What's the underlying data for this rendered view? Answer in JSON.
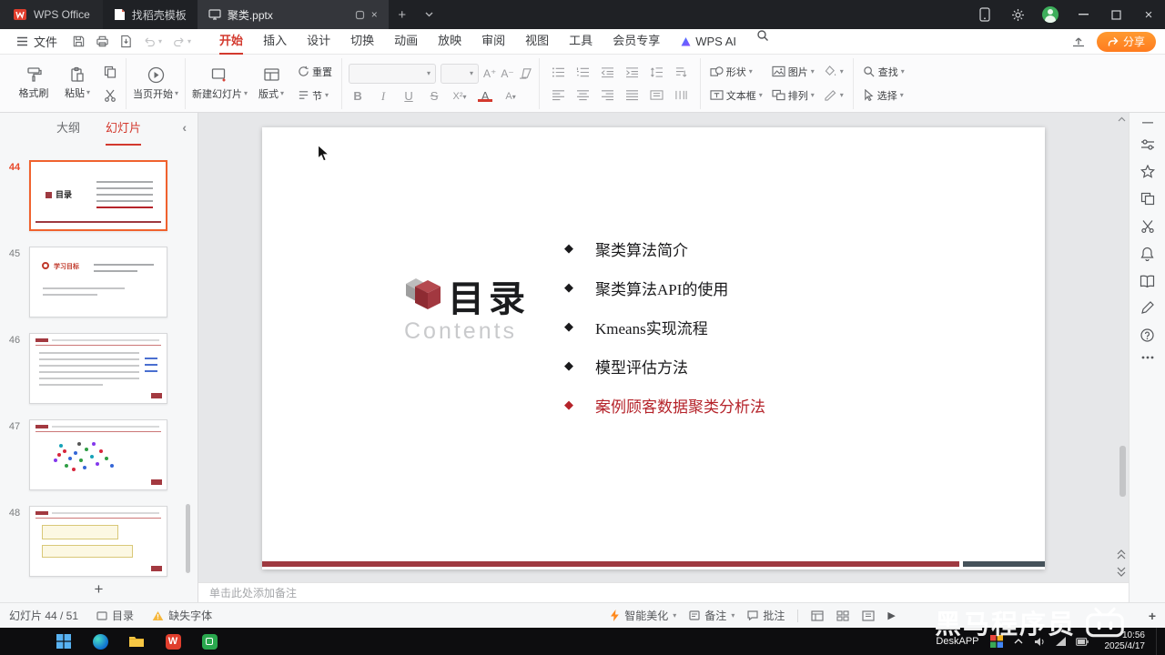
{
  "colors": {
    "accent_red": "#d3392e",
    "share_orange": "#ff7c1f",
    "slide_red": "#9e3940",
    "slide_bar_gray": "#45525a",
    "toc_highlight_red": "#b5232a",
    "selected_thumb_border": "#f0622e",
    "warning_yellow": "#f6b73c",
    "titlebar_bg": "#1f2125",
    "taskbar_bg": "#0d0d0f"
  },
  "titlebar": {
    "app_tab": "WPS Office",
    "template_tab": "找稻壳模板",
    "document_tab": "聚类.pptx"
  },
  "menubar": {
    "file": "文件",
    "tabs": [
      "开始",
      "插入",
      "设计",
      "切换",
      "动画",
      "放映",
      "审阅",
      "视图",
      "工具",
      "会员专享",
      "WPS AI"
    ],
    "share": "分享"
  },
  "toolbar": {
    "format_painter": "格式刷",
    "paste": "粘贴",
    "start_from_current": "当页开始",
    "new_slide": "新建幻灯片",
    "layout": "版式",
    "reset": "重置",
    "section": "节",
    "shapes": "形状",
    "picture": "图片",
    "textbox": "文本框",
    "arrange": "排列",
    "find": "查找",
    "select": "选择"
  },
  "slide_panel": {
    "outline_tab": "大纲",
    "slides_tab": "幻灯片",
    "thumbnails": [
      {
        "num": "44",
        "title": "目录"
      },
      {
        "num": "45",
        "title": "学习目标"
      },
      {
        "num": "46",
        "title": ""
      },
      {
        "num": "47",
        "title": ""
      },
      {
        "num": "48",
        "title": ""
      }
    ]
  },
  "slide": {
    "title": "目录",
    "subtitle": "Contents",
    "items": [
      {
        "text": "聚类算法简介"
      },
      {
        "text": "聚类算法API的使用"
      },
      {
        "text": "Kmeans实现流程"
      },
      {
        "text": "模型评估方法"
      },
      {
        "text": "案例顾客数据聚类分析法"
      }
    ]
  },
  "notes": {
    "placeholder": "单击此处添加备注"
  },
  "statusbar": {
    "slide_counter": "幻灯片 44 / 51",
    "section_name": "目录",
    "missing_fonts": "缺失字体",
    "beautify": "智能美化",
    "notes": "备注",
    "comments": "批注"
  },
  "taskbar": {
    "deskapp": "DeskAPP",
    "time": "10:56",
    "date": "2025/4/17"
  },
  "watermark": {
    "text": "黑马程序员"
  }
}
